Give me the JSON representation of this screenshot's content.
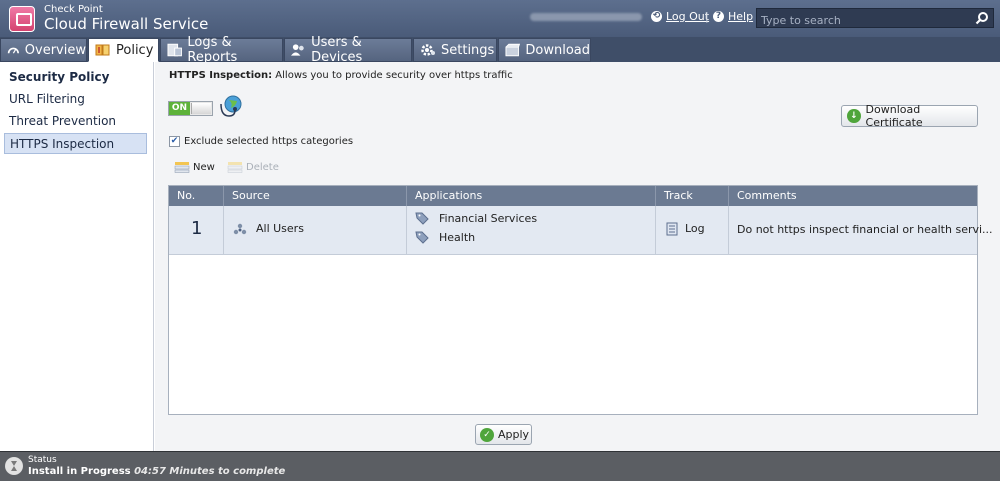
{
  "header": {
    "brand_top": "Check Point",
    "brand_main": "Cloud Firewall Service",
    "logout_label": "Log Out",
    "separator": "|",
    "help_label": "Help",
    "search_placeholder": "Type to search"
  },
  "tabs": [
    {
      "label": "Overview",
      "icon": "gauge-icon"
    },
    {
      "label": "Policy",
      "icon": "book-icon",
      "active": true
    },
    {
      "label": "Logs & Reports",
      "icon": "report-icon"
    },
    {
      "label": "Users & Devices",
      "icon": "users-icon"
    },
    {
      "label": "Settings",
      "icon": "gear-icon"
    },
    {
      "label": "Download",
      "icon": "box-icon"
    }
  ],
  "sidebar": {
    "items": [
      {
        "label": "Security Policy"
      },
      {
        "label": "URL Filtering"
      },
      {
        "label": "Threat Prevention"
      },
      {
        "label": "HTTPS Inspection",
        "active": true
      }
    ]
  },
  "main": {
    "desc_title": "HTTPS Inspection:",
    "desc_text": " Allows you to provide security over https traffic",
    "toggle_label": "ON",
    "toggle_state": "on",
    "download_cert_label": "Download Certificate",
    "exclude_label": "Exclude selected https categories",
    "exclude_checked": true,
    "new_label": "New",
    "delete_label": "Delete",
    "apply_label": "Apply"
  },
  "table": {
    "headers": [
      "No.",
      "Source",
      "Applications",
      "Track",
      "Comments"
    ],
    "rows": [
      {
        "no": "1",
        "source": "All Users",
        "applications": [
          "Financial Services",
          "Health"
        ],
        "track": "Log",
        "comments": "Do not https inspect financial or health servi..."
      }
    ]
  },
  "status": {
    "label": "Status",
    "message": "Install in Progress",
    "time": "04:57 Minutes to complete"
  },
  "colors": {
    "header_bg": "#4a5b79",
    "accent_green": "#5db23a",
    "row_selected": "#e3e9f2",
    "status_bg": "#5b5e63"
  }
}
